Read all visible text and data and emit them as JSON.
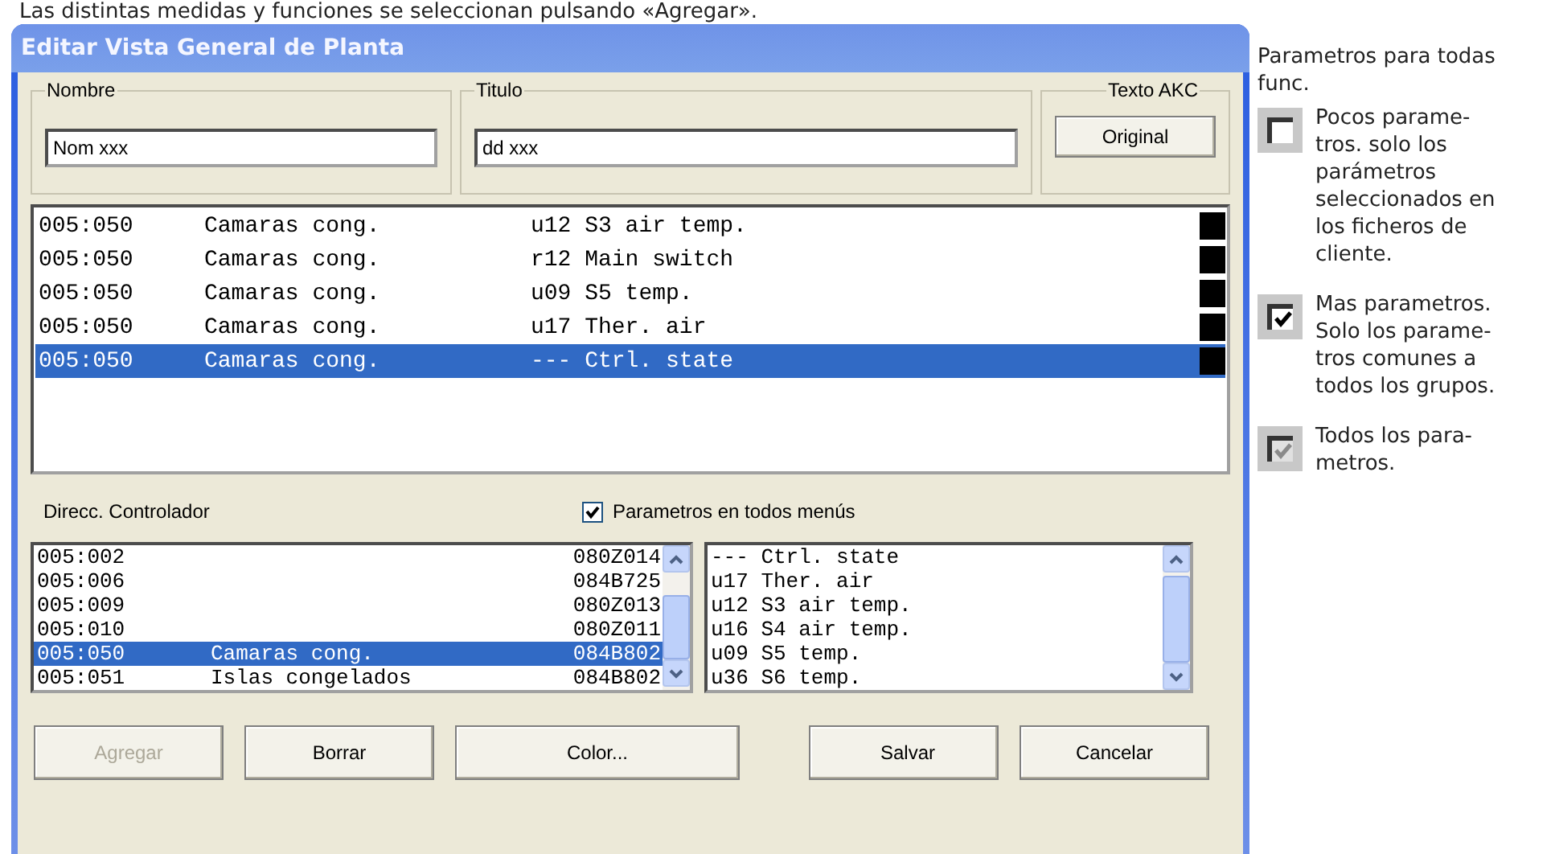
{
  "caption": "Las distintas medidas y funciones se seleccionan pulsando «Agregar».",
  "window": {
    "title": "Editar Vista General de Planta"
  },
  "groups": [
    {
      "label": "Nombre",
      "kind": "field",
      "value": "Nom xxx"
    },
    {
      "label": "Titulo",
      "kind": "field",
      "value": "dd xxx"
    },
    {
      "label": "Texto AKC",
      "kind": "button",
      "value": "Original"
    }
  ],
  "measurements": [
    {
      "address": "005:050",
      "group": "Camaras cong.",
      "parameter": "u12 S3 air temp.",
      "color": "#000000",
      "selected": false
    },
    {
      "address": "005:050",
      "group": "Camaras cong.",
      "parameter": "r12 Main switch",
      "color": "#000000",
      "selected": false
    },
    {
      "address": "005:050",
      "group": "Camaras cong.",
      "parameter": "u09 S5 temp.",
      "color": "#000000",
      "selected": false
    },
    {
      "address": "005:050",
      "group": "Camaras cong.",
      "parameter": "u17 Ther. air",
      "color": "#000000",
      "selected": false
    },
    {
      "address": "005:050",
      "group": "Camaras cong.",
      "parameter": "--- Ctrl. state",
      "color": "#000000",
      "selected": true
    }
  ],
  "controller_label": "Direcc. Controlador",
  "all_menus_checkbox": {
    "label": "Parametros en todos menús",
    "checked": true
  },
  "controllers": [
    {
      "address": "005:002",
      "code": "080Z014",
      "selected": false
    },
    {
      "address": "005:006",
      "code": "084B725",
      "selected": false
    },
    {
      "address": "005:009",
      "code": "080Z013",
      "selected": false
    },
    {
      "address": "005:010",
      "code": "080Z011",
      "selected": false
    },
    {
      "address": "005:050",
      "name": "Camaras cong.",
      "code": "084B802",
      "selected": true
    },
    {
      "address": "005:051",
      "name": "Islas congelados",
      "code": "084B802",
      "selected": false
    }
  ],
  "parameters": [
    "--- Ctrl. state",
    "u17 Ther. air",
    "u12 S3 air temp.",
    "u16 S4 air temp.",
    "u09 S5 temp.",
    "u36 S6 temp."
  ],
  "buttons": [
    {
      "label": "Agregar",
      "disabled": true
    },
    {
      "label": "Borrar",
      "disabled": false
    },
    {
      "label": "Color...",
      "disabled": false
    },
    {
      "label": "Salvar",
      "disabled": false
    },
    {
      "label": "Cancelar",
      "disabled": false
    }
  ],
  "legend": {
    "title": "Parametros para todas func.",
    "items": [
      {
        "kind": "unchecked",
        "text": "Pocos parame-tros. solo los parámetros seleccionados en los ficheros de cliente."
      },
      {
        "kind": "checked",
        "text": "Mas parametros. Solo los parame-tros comunes a todos los grupos."
      },
      {
        "kind": "indeterminate",
        "text": "Todos los para-metros."
      }
    ]
  }
}
